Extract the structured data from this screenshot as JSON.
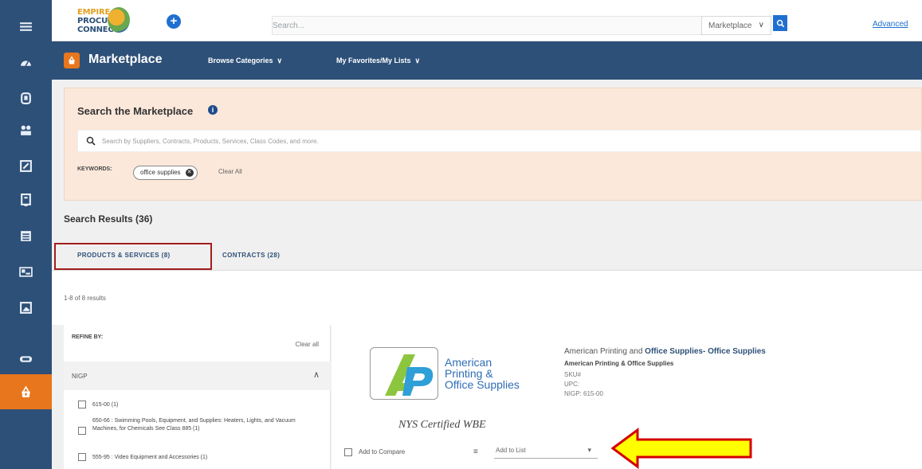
{
  "rail": {
    "items": [
      {
        "name": "menu-icon",
        "glyph": "hamburger"
      },
      {
        "name": "dashboard-icon",
        "glyph": "gauge"
      },
      {
        "name": "documents-icon",
        "glyph": "document"
      },
      {
        "name": "people-icon",
        "glyph": "users"
      },
      {
        "name": "edit-icon",
        "glyph": "pencil-box"
      },
      {
        "name": "forms-icon",
        "glyph": "form"
      },
      {
        "name": "list-icon",
        "glyph": "list"
      },
      {
        "name": "cards-icon",
        "glyph": "id-card"
      },
      {
        "name": "reports-icon",
        "glyph": "chart"
      },
      {
        "name": "badge-icon",
        "glyph": "badge"
      },
      {
        "name": "marketplace-icon",
        "glyph": "basket"
      }
    ],
    "accent": "#e8761c",
    "background": "#2d5078"
  },
  "topbar": {
    "logo_lines": [
      "EMPIRE",
      "PROCURE",
      "CONNECT"
    ],
    "search_placeholder": "Search...",
    "scope": "Marketplace",
    "advanced_label": "Advanced"
  },
  "marketplace_bar": {
    "title": "Marketplace",
    "nav": [
      "Browse Categories",
      "My Favorites/My Lists"
    ]
  },
  "search_panel": {
    "title": "Search the Marketplace",
    "placeholder": "Search by Suppliers, Contracts, Products, Services, Class Codes, and more.",
    "keywords_label": "KEYWORDS:",
    "keyword_chip": "office supplies",
    "clear_all": "Clear All"
  },
  "results": {
    "title": "Search Results (36)",
    "tabs": [
      "PRODUCTS & SERVICES (8)",
      "CONTRACTS (28)"
    ],
    "count": "1-8 of 8 results"
  },
  "refine": {
    "label": "REFINE BY:",
    "clear_all": "Clear all",
    "section": "NIGP",
    "filters": [
      {
        "text": "615-00 (1)"
      },
      {
        "text": "650-66 : Swimming Pools, Equipment, and Supplies: Heaters, Lights, and Vacuum Machines, for Chemicals See Class 885 (1)"
      },
      {
        "text": "555-95 : Video Equipment and Accessories (1)"
      }
    ]
  },
  "product": {
    "logo_text": [
      "American",
      "Printing &",
      "Office Supplies"
    ],
    "certification": "NYS Certified WBE",
    "title_prefix": "American Printing and ",
    "title_bold": "Office Supplies- Office Supplies",
    "supplier": "American Printing & Office Supplies",
    "sku": "SKU#",
    "upc": "UPC:",
    "nigp": "NIGP: 615-00",
    "add_to_compare": "Add to Compare",
    "add_to_list": "Add to List"
  },
  "colors": {
    "navy": "#2d5078",
    "orange": "#e8761c",
    "blue": "#1f6fd1",
    "highlight_box": "#a31d1d",
    "arrow_fill": "#ffff00",
    "arrow_stroke": "#d40000"
  }
}
